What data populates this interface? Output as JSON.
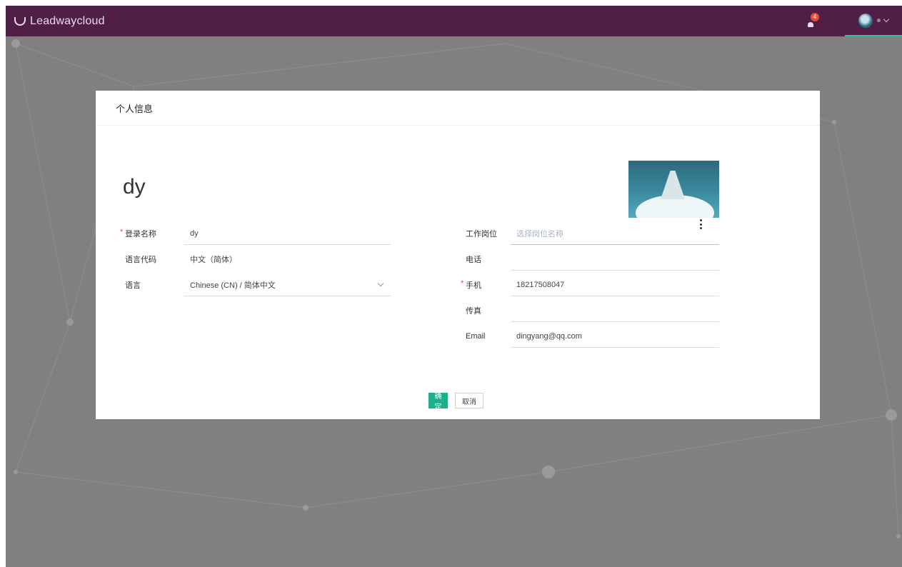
{
  "app": {
    "title": "Leadwaycloud"
  },
  "topbar": {
    "notification_count": "4",
    "bell_icon": "bell-icon",
    "dropdown_icon": "chevron-down-icon"
  },
  "modal": {
    "title": "个人信息",
    "user_display_name": "dy",
    "left_fields": [
      {
        "label": "登录名称",
        "value": "dy",
        "required": true
      },
      {
        "label": "语言代码",
        "value": "中文（简体）",
        "required": false
      },
      {
        "label": "语言",
        "value": "Chinese (CN) / 简体中文",
        "required": false
      }
    ],
    "right_fields": [
      {
        "label": "工作岗位",
        "value": "",
        "placeholder": "选择岗位名称",
        "required": false
      },
      {
        "label": "电话",
        "value": "",
        "required": false
      },
      {
        "label": "手机",
        "value": "18217508047",
        "required": true
      },
      {
        "label": "传真",
        "value": "",
        "required": false
      },
      {
        "label": "Email",
        "value": "dingyang@qq.com",
        "required": false
      }
    ],
    "buttons": {
      "ok": "确定",
      "cancel": "取消"
    }
  },
  "colors": {
    "topbar": "#4f1f45",
    "accent": "#1fae8a",
    "required": "#e74c3c",
    "overlay": "#808080"
  }
}
